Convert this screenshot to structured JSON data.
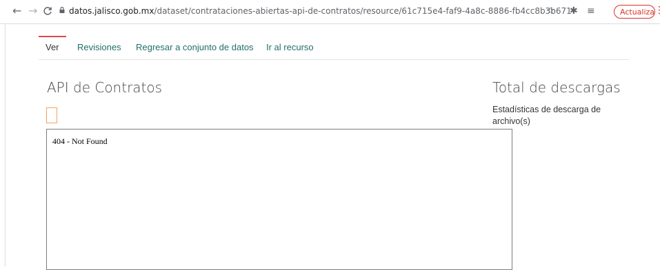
{
  "browser": {
    "back_glyph": "←",
    "forward_glyph": "→",
    "reload_glyph": "C",
    "url_host": "datos.jalisco.gob.mx",
    "url_path": "/dataset/contrataciones-abiertas-api-de-contratos/resource/61c715e4-faf9-4a8c-8886-fb4cc8b3b671",
    "star_glyph": "☆",
    "extensions_glyph": "✱",
    "readinglist_glyph": "≡",
    "update_label": "Actualizar",
    "menu_glyph": "⋮",
    "icons": [
      "back-icon",
      "forward-icon",
      "reload-icon",
      "lock-icon",
      "star-icon",
      "puzzle-icon",
      "reading-list-icon",
      "menu-icon"
    ],
    "accent_color": "#d93025"
  },
  "tabs": [
    {
      "label": "Ver"
    },
    {
      "label": "Revisiones"
    },
    {
      "label": "Regresar a conjunto de datos"
    },
    {
      "label": "Ir al recurso"
    }
  ],
  "resource": {
    "title": "API de Contratos",
    "frame_text": "404 - Not Found"
  },
  "downloads": {
    "title": "Total de descargas",
    "subtitle": "Estadísticas de descarga de archivo(s)"
  },
  "colors": {
    "tab_active_border": "#e0464b",
    "tab_link": "#1f6f6a",
    "placeholder_border": "#f3a25a"
  }
}
